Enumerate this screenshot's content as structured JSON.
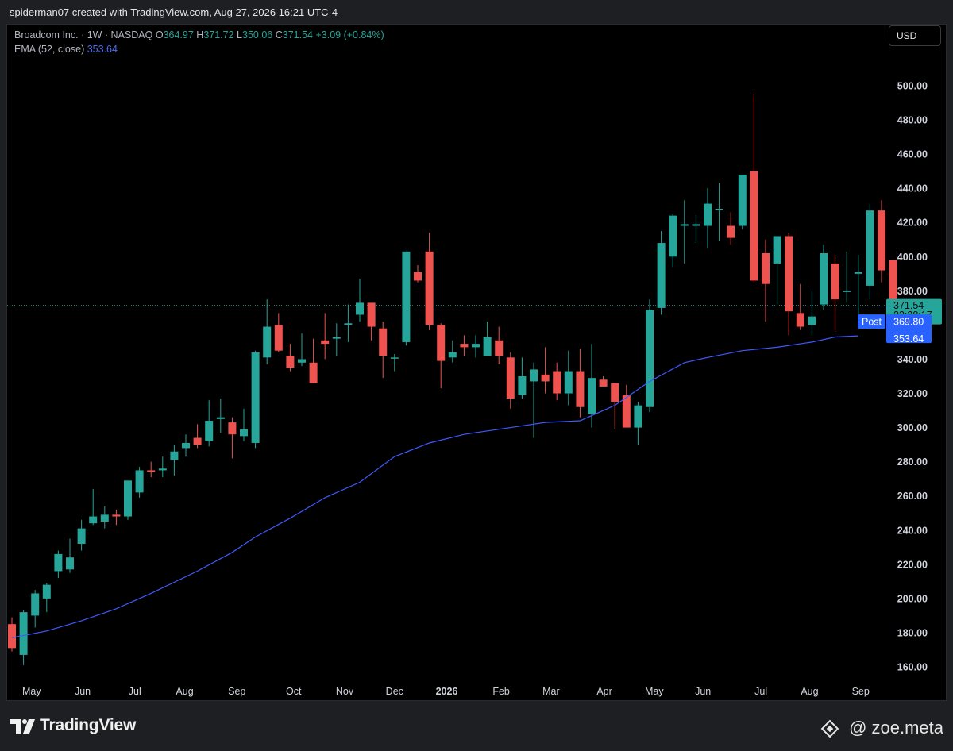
{
  "header": {
    "credit": "spiderman07 created with TradingView.com, Aug 27, 2026 16:21 UTC-4"
  },
  "legend": {
    "symbol": "Broadcom Inc. · 1W · NASDAQ",
    "o_label": "O",
    "o_value": "364.97",
    "h_label": "H",
    "h_value": "371.72",
    "l_label": "L",
    "l_value": "350.06",
    "c_label": "C",
    "c_value": "371.54",
    "change": "+3.09 (+0.84%)",
    "ema_label": "EMA (52, close)",
    "ema_value": "353.64"
  },
  "currency_button": "USD",
  "footer": {
    "brand": "TradingView",
    "handle": "@ zoe.meta"
  },
  "colors": {
    "up": "#26a69a",
    "down": "#ef5350",
    "ema": "#3d5afe",
    "background": "#000000",
    "post_badge": "#2962ff"
  },
  "chart_data": {
    "type": "candlestick",
    "interval": "1W",
    "ylim": [
      150,
      510
    ],
    "y_ticks": [
      160,
      180,
      200,
      220,
      240,
      260,
      280,
      300,
      320,
      340,
      380,
      400,
      420,
      440,
      460,
      480,
      500
    ],
    "y_tick_labels": [
      "160.00",
      "180.00",
      "200.00",
      "220.00",
      "240.00",
      "260.00",
      "280.00",
      "300.00",
      "320.00",
      "340.00",
      "380.00",
      "400.00",
      "420.00",
      "440.00",
      "460.00",
      "480.00",
      "500.00"
    ],
    "x_labels": [
      {
        "label": "May",
        "index": 1.7
      },
      {
        "label": "Jun",
        "index": 6.1
      },
      {
        "label": "Jul",
        "index": 10.6
      },
      {
        "label": "Aug",
        "index": 14.9
      },
      {
        "label": "Sep",
        "index": 19.4
      },
      {
        "label": "Oct",
        "index": 24.3
      },
      {
        "label": "Nov",
        "index": 28.7
      },
      {
        "label": "Dec",
        "index": 33.0
      },
      {
        "label": "2026",
        "index": 37.5,
        "bold": true
      },
      {
        "label": "Feb",
        "index": 42.2
      },
      {
        "label": "Mar",
        "index": 46.5
      },
      {
        "label": "Apr",
        "index": 51.1
      },
      {
        "label": "May",
        "index": 55.4
      },
      {
        "label": "Jun",
        "index": 59.6
      },
      {
        "label": "Jul",
        "index": 64.6
      },
      {
        "label": "Aug",
        "index": 68.8
      },
      {
        "label": "Sep",
        "index": 73.2
      }
    ],
    "candles": [
      {
        "o": 185,
        "h": 189,
        "l": 169,
        "c": 171
      },
      {
        "o": 167,
        "h": 193,
        "l": 161,
        "c": 192
      },
      {
        "o": 190,
        "h": 205,
        "l": 183,
        "c": 203
      },
      {
        "o": 200,
        "h": 209,
        "l": 192,
        "c": 208
      },
      {
        "o": 216,
        "h": 228,
        "l": 212,
        "c": 226
      },
      {
        "o": 217,
        "h": 235,
        "l": 215,
        "c": 224
      },
      {
        "o": 232,
        "h": 246,
        "l": 228,
        "c": 241
      },
      {
        "o": 244,
        "h": 264,
        "l": 243,
        "c": 248
      },
      {
        "o": 245,
        "h": 254,
        "l": 241,
        "c": 249
      },
      {
        "o": 249,
        "h": 252,
        "l": 243,
        "c": 248
      },
      {
        "o": 248,
        "h": 260,
        "l": 246,
        "c": 269
      },
      {
        "o": 262,
        "h": 277,
        "l": 259,
        "c": 275
      },
      {
        "o": 275,
        "h": 280,
        "l": 271,
        "c": 274
      },
      {
        "o": 275,
        "h": 283,
        "l": 271,
        "c": 276
      },
      {
        "o": 281,
        "h": 290,
        "l": 272,
        "c": 286
      },
      {
        "o": 288,
        "h": 296,
        "l": 283,
        "c": 291
      },
      {
        "o": 294,
        "h": 302,
        "l": 288,
        "c": 290
      },
      {
        "o": 292,
        "h": 316,
        "l": 289,
        "c": 304
      },
      {
        "o": 305,
        "h": 317,
        "l": 297,
        "c": 306
      },
      {
        "o": 303,
        "h": 306,
        "l": 282,
        "c": 296
      },
      {
        "o": 295,
        "h": 311,
        "l": 292,
        "c": 299
      },
      {
        "o": 291,
        "h": 345,
        "l": 288,
        "c": 344
      },
      {
        "o": 341,
        "h": 375,
        "l": 337,
        "c": 359
      },
      {
        "o": 360,
        "h": 367,
        "l": 344,
        "c": 345
      },
      {
        "o": 342,
        "h": 349,
        "l": 333,
        "c": 335
      },
      {
        "o": 338,
        "h": 355,
        "l": 336,
        "c": 340
      },
      {
        "o": 338,
        "h": 352,
        "l": 331,
        "c": 326
      },
      {
        "o": 351,
        "h": 367,
        "l": 340,
        "c": 349
      },
      {
        "o": 352,
        "h": 361,
        "l": 342,
        "c": 353
      },
      {
        "o": 360,
        "h": 372,
        "l": 350,
        "c": 361
      },
      {
        "o": 366,
        "h": 387,
        "l": 362,
        "c": 373
      },
      {
        "o": 373,
        "h": 371,
        "l": 351,
        "c": 359
      },
      {
        "o": 358,
        "h": 362,
        "l": 329,
        "c": 342
      },
      {
        "o": 341,
        "h": 343,
        "l": 333,
        "c": 341
      },
      {
        "o": 350,
        "h": 378,
        "l": 348,
        "c": 403
      },
      {
        "o": 391,
        "h": 395,
        "l": 385,
        "c": 386
      },
      {
        "o": 403,
        "h": 414,
        "l": 357,
        "c": 360
      },
      {
        "o": 360,
        "h": 361,
        "l": 323,
        "c": 339
      },
      {
        "o": 341,
        "h": 351,
        "l": 338,
        "c": 344
      },
      {
        "o": 349,
        "h": 354,
        "l": 342,
        "c": 347
      },
      {
        "o": 347,
        "h": 354,
        "l": 341,
        "c": 349
      },
      {
        "o": 342,
        "h": 362,
        "l": 344,
        "c": 353
      },
      {
        "o": 351,
        "h": 359,
        "l": 337,
        "c": 342
      },
      {
        "o": 341,
        "h": 344,
        "l": 311,
        "c": 317
      },
      {
        "o": 319,
        "h": 341,
        "l": 317,
        "c": 330
      },
      {
        "o": 327,
        "h": 338,
        "l": 294,
        "c": 334
      },
      {
        "o": 331,
        "h": 347,
        "l": 320,
        "c": 327
      },
      {
        "o": 333,
        "h": 338,
        "l": 316,
        "c": 320
      },
      {
        "o": 320,
        "h": 345,
        "l": 313,
        "c": 333
      },
      {
        "o": 333,
        "h": 346,
        "l": 306,
        "c": 312
      },
      {
        "o": 308,
        "h": 349,
        "l": 300,
        "c": 329
      },
      {
        "o": 328,
        "h": 330,
        "l": 326,
        "c": 324
      },
      {
        "o": 326,
        "h": 325,
        "l": 299,
        "c": 315
      },
      {
        "o": 319,
        "h": 325,
        "l": 305,
        "c": 300
      },
      {
        "o": 300,
        "h": 315,
        "l": 290,
        "c": 313
      },
      {
        "o": 312,
        "h": 375,
        "l": 309,
        "c": 369
      },
      {
        "o": 370,
        "h": 415,
        "l": 366,
        "c": 408
      },
      {
        "o": 400,
        "h": 425,
        "l": 394,
        "c": 424
      },
      {
        "o": 418,
        "h": 433,
        "l": 396,
        "c": 419
      },
      {
        "o": 418,
        "h": 424,
        "l": 408,
        "c": 419
      },
      {
        "o": 418,
        "h": 440,
        "l": 405,
        "c": 431
      },
      {
        "o": 428,
        "h": 443,
        "l": 409,
        "c": 428
      },
      {
        "o": 418,
        "h": 426,
        "l": 407,
        "c": 411
      },
      {
        "o": 418,
        "h": 447,
        "l": 416,
        "c": 448
      },
      {
        "o": 450,
        "h": 495,
        "l": 385,
        "c": 386
      },
      {
        "o": 402,
        "h": 410,
        "l": 362,
        "c": 384
      },
      {
        "o": 396,
        "h": 408,
        "l": 372,
        "c": 412
      },
      {
        "o": 412,
        "h": 414,
        "l": 354,
        "c": 368
      },
      {
        "o": 367,
        "h": 384,
        "l": 357,
        "c": 359
      },
      {
        "o": 360,
        "h": 380,
        "l": 354,
        "c": 365
      },
      {
        "o": 372,
        "h": 407,
        "l": 369,
        "c": 402
      },
      {
        "o": 396,
        "h": 401,
        "l": 356,
        "c": 375
      },
      {
        "o": 380,
        "h": 403,
        "l": 373,
        "c": 380
      },
      {
        "o": 390,
        "h": 401,
        "l": 366,
        "c": 391
      },
      {
        "o": 383,
        "h": 431,
        "l": 375,
        "c": 427
      },
      {
        "o": 427,
        "h": 433,
        "l": 385,
        "c": 392
      },
      {
        "o": 398,
        "h": 396,
        "l": 359,
        "c": 368
      },
      {
        "o": 364.97,
        "h": 371.72,
        "l": 350.06,
        "c": 371.54
      }
    ],
    "ema": {
      "name": "EMA (52, close)",
      "points": [
        {
          "i": 0,
          "v": 177
        },
        {
          "i": 3,
          "v": 181
        },
        {
          "i": 6,
          "v": 187
        },
        {
          "i": 9,
          "v": 194
        },
        {
          "i": 12,
          "v": 203
        },
        {
          "i": 16,
          "v": 216
        },
        {
          "i": 19,
          "v": 227
        },
        {
          "i": 21,
          "v": 236
        },
        {
          "i": 24,
          "v": 247
        },
        {
          "i": 27,
          "v": 259
        },
        {
          "i": 30,
          "v": 268
        },
        {
          "i": 33,
          "v": 283
        },
        {
          "i": 36,
          "v": 291
        },
        {
          "i": 39,
          "v": 296
        },
        {
          "i": 42,
          "v": 299
        },
        {
          "i": 46,
          "v": 303
        },
        {
          "i": 49,
          "v": 304
        },
        {
          "i": 52,
          "v": 313
        },
        {
          "i": 55,
          "v": 327
        },
        {
          "i": 58,
          "v": 338
        },
        {
          "i": 60,
          "v": 341
        },
        {
          "i": 63,
          "v": 345
        },
        {
          "i": 66,
          "v": 347
        },
        {
          "i": 69,
          "v": 350
        },
        {
          "i": 71,
          "v": 353
        },
        {
          "i": 73,
          "v": 353.64
        }
      ]
    },
    "current_price_line": 371.54,
    "price_labels": [
      {
        "text": "371.54",
        "value": 371.54,
        "kind": "last"
      },
      {
        "text": "23:38:17",
        "value": 367,
        "kind": "countdown"
      },
      {
        "text": "369.80",
        "value": 362,
        "kind": "post"
      },
      {
        "text": "353.64",
        "value": 357,
        "kind": "ema"
      }
    ],
    "post_badge": "Post"
  }
}
